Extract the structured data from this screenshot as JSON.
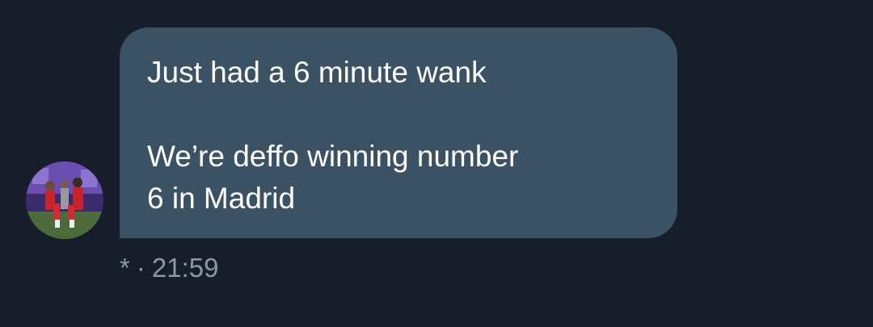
{
  "message": {
    "lines": [
      "Just had a 6 minute wank",
      "We’re deffo winning number",
      "6 in Madrid"
    ]
  },
  "meta": {
    "status": "*",
    "separator": "·",
    "time": "21:59"
  },
  "colors": {
    "background": "#151e29",
    "bubble": "#3b5164",
    "text": "#ffffff",
    "meta_text": "#8a99a8"
  },
  "icons": {
    "avatar": "sender-avatar-photo"
  }
}
